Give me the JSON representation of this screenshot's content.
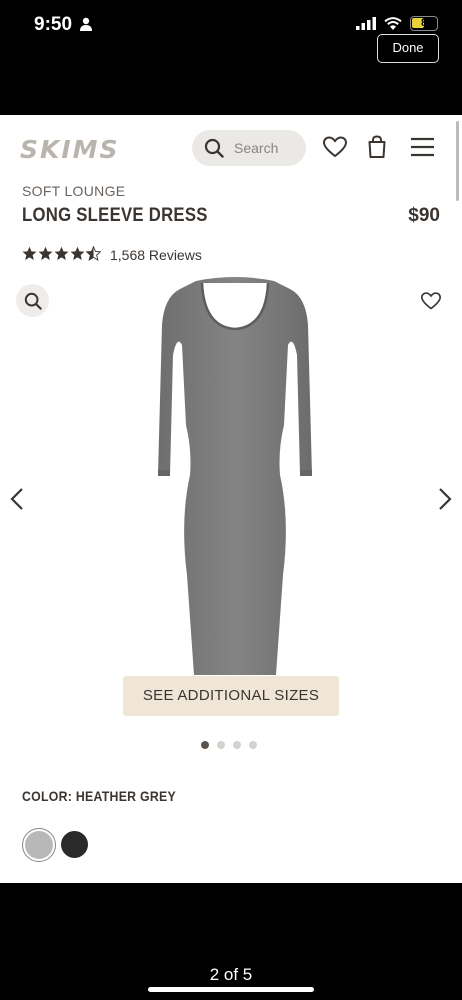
{
  "status": {
    "time": "9:50",
    "battery": "8",
    "done_label": "Done"
  },
  "header": {
    "logo": "SKIMS",
    "search_label": "Search"
  },
  "product": {
    "eyebrow": "SOFT LOUNGE",
    "title": "LONG SLEEVE DRESS",
    "price": "$90",
    "rating": 4.5,
    "reviews": "1,568 Reviews",
    "sizes_button": "SEE ADDITIONAL SIZES",
    "color_label": "COLOR: HEATHER GREY",
    "image_count": 4,
    "active_image": 1
  },
  "colors": {
    "accent_tan": "#efe6d8",
    "text": "#3b3531",
    "swatch_grey": "#b9b8b8",
    "swatch_black": "#2a2a2b",
    "dress": "#7b7a7a"
  },
  "viewer": {
    "page_count": "2 of 5"
  }
}
